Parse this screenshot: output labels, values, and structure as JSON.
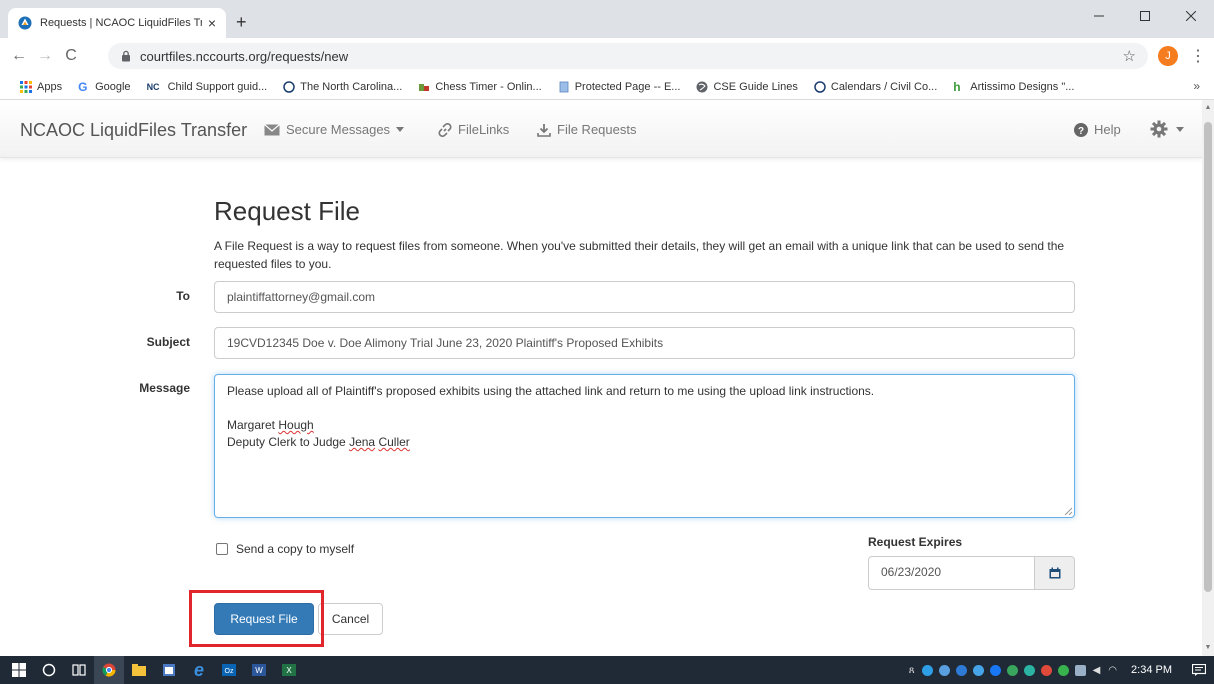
{
  "browser": {
    "tab_title": "Requests | NCAOC LiquidFiles Tra",
    "tab_close": "×",
    "new_tab": "+",
    "url": "courtfiles.nccourts.org/requests/new",
    "profile_initial": "J",
    "bookmarks": [
      {
        "label": "Apps",
        "icon": "apps-grid-icon"
      },
      {
        "label": "Google",
        "icon": "google-g-icon"
      },
      {
        "label": "Child Support guid...",
        "icon": "nc-icon"
      },
      {
        "label": "The North Carolina...",
        "icon": "circle-icon"
      },
      {
        "label": "Chess Timer - Onlin...",
        "icon": "chess-icon"
      },
      {
        "label": "Protected Page -- E...",
        "icon": "document-icon"
      },
      {
        "label": "CSE Guide Lines",
        "icon": "globe-icon"
      },
      {
        "label": "Calendars / Civil Co...",
        "icon": "circle-icon"
      },
      {
        "label": "Artissimo Designs \"...",
        "icon": "h-logo-icon"
      }
    ],
    "bookmarks_more": "»"
  },
  "navbar": {
    "brand": "NCAOC LiquidFiles Transfer",
    "secure_messages": "Secure Messages",
    "filelinks": "FileLinks",
    "file_requests": "File Requests",
    "help": "Help"
  },
  "form": {
    "title": "Request File",
    "intro": "A File Request is a way to request files from someone. When you've submitted their details, they will get an email with a unique link that can be used to send the requested files to you.",
    "to_label": "To",
    "to_value": "plaintiffattorney@gmail.com",
    "subject_label": "Subject",
    "subject_value": "19CVD12345 Doe v. Doe Alimony Trial June 23, 2020 Plaintiff's Proposed Exhibits",
    "message_label": "Message",
    "message": {
      "line1": "Please upload all of Plaintiff's proposed exhibits using the attached link and return to me using the upload link instructions.",
      "sig_name_first": "Margaret ",
      "sig_name_last": "Hough",
      "sig_title_prefix": "Deputy Clerk to Judge ",
      "sig_judge_first": "Jena",
      "sig_judge_last": "Culler"
    },
    "send_copy_label": "Send a copy to myself",
    "expires_label": "Request Expires",
    "expires_value": "06/23/2020",
    "submit_label": "Request File",
    "cancel_label": "Cancel"
  },
  "taskbar": {
    "clock": "2:34 PM"
  },
  "colors": {
    "primary": "#337ab7",
    "highlight": "#e0262b",
    "taskbar": "#1f2a36"
  }
}
